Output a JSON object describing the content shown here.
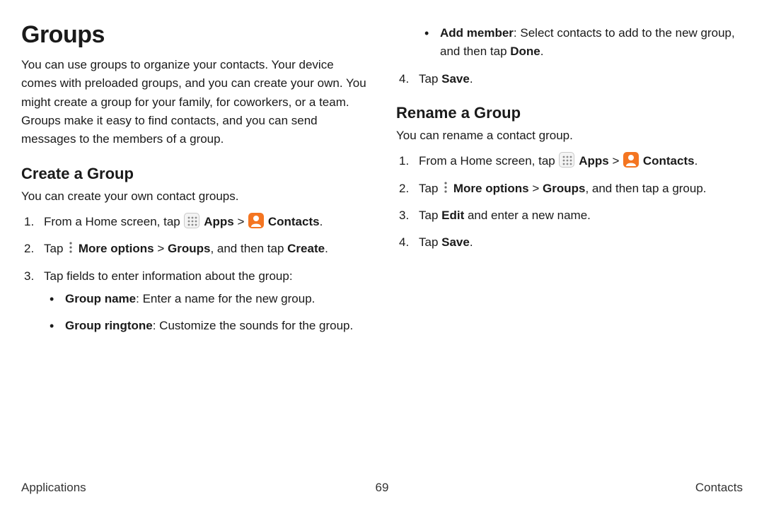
{
  "title": "Groups",
  "intro": "You can use groups to organize your contacts. Your device comes with preloaded groups, and you can create your own. You might create a group for your family, for coworkers, or a team. Groups make it easy to find contacts, and you can send messages to the members of a group.",
  "create": {
    "heading": "Create a Group",
    "intro": "You can create your own contact groups.",
    "step1_prefix": "From a Home screen, tap ",
    "apps_label": "Apps",
    "chevron": " > ",
    "contacts_label": "Contacts",
    "period": ".",
    "step2_prefix": "Tap ",
    "more_label": "More options",
    "groups_label": "Groups",
    "step2_mid": ", and then tap ",
    "create_label": "Create",
    "step3": "Tap fields to enter information about the group:",
    "bullet1_label": "Group name",
    "bullet1_text": ": Enter a name for the new group.",
    "bullet2_label": "Group ringtone",
    "bullet2_text": ": Customize the sounds for the group."
  },
  "rightcol": {
    "add_member_label": "Add member",
    "add_member_text": ": Select contacts to add to the new group, and then tap ",
    "done_label": "Done",
    "step4_prefix": "Tap ",
    "save_label": "Save"
  },
  "rename": {
    "heading": "Rename a Group",
    "intro": "You can rename a contact group.",
    "step1_prefix": "From a Home screen, tap ",
    "apps_label": "Apps",
    "chevron": " > ",
    "contacts_label": "Contacts",
    "period": ".",
    "step2_prefix": "Tap ",
    "more_label": "More options",
    "groups_label": "Groups",
    "step2_suffix": ", and then tap a group.",
    "step3_prefix": "Tap ",
    "edit_label": "Edit",
    "step3_suffix": " and enter a new name.",
    "step4_prefix": "Tap ",
    "save_label": "Save"
  },
  "footer": {
    "left": "Applications",
    "page": "69",
    "right": "Contacts"
  }
}
